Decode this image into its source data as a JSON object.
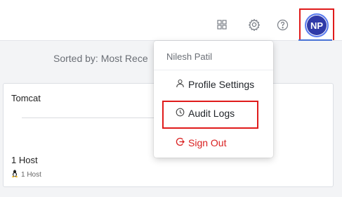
{
  "header": {
    "icons": [
      "grid-icon",
      "gear-icon",
      "help-icon"
    ],
    "avatar_initials": "NP"
  },
  "main": {
    "sort_label": "Sorted by: Most Rece",
    "card": {
      "title": "Tomcat",
      "count": "1 Host",
      "sub_label": "1 Host"
    }
  },
  "user_menu": {
    "user_name": "Nilesh Patil",
    "items": [
      {
        "label": "Profile Settings",
        "icon": "user-icon"
      },
      {
        "label": "Audit Logs",
        "icon": "clock-icon"
      },
      {
        "label": "Sign Out",
        "icon": "signout-icon"
      }
    ]
  },
  "colors": {
    "avatar_bg": "#2f3aa8",
    "highlight": "#e01b1b",
    "sign_out": "#d92020",
    "accent": "#4a73d6"
  }
}
